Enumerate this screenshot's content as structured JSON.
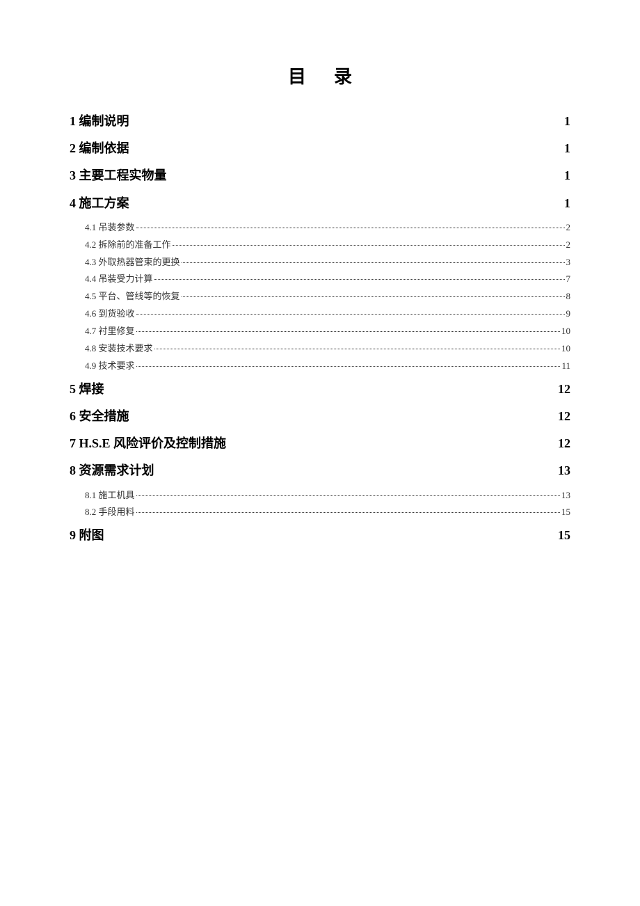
{
  "title": "目录",
  "toc": [
    {
      "num": "1",
      "label": "编制说明",
      "page": "1",
      "children": []
    },
    {
      "num": "2",
      "label": "编制依据",
      "page": "1",
      "children": []
    },
    {
      "num": "3",
      "label": "主要工程实物量",
      "page": "1",
      "children": []
    },
    {
      "num": "4",
      "label": "施工方案",
      "page": "1",
      "children": [
        {
          "num": "4.1",
          "label": "吊装参数",
          "page": "2"
        },
        {
          "num": "4.2",
          "label": "拆除前的准备工作",
          "page": "2"
        },
        {
          "num": "4.3",
          "label": "外取热器管束的更换",
          "page": "3"
        },
        {
          "num": "4.4",
          "label": "吊装受力计算",
          "page": "7"
        },
        {
          "num": "4.5",
          "label": "平台、管线等的恢复",
          "page": "8"
        },
        {
          "num": "4.6",
          "label": "到货验收",
          "page": "9"
        },
        {
          "num": "4.7",
          "label": "衬里修复",
          "page": "10"
        },
        {
          "num": "4.8",
          "label": "安装技术要求",
          "page": "10"
        },
        {
          "num": "4.9",
          "label": "技术要求",
          "page": "11"
        }
      ]
    },
    {
      "num": "5",
      "label": "焊接",
      "page": "12",
      "children": []
    },
    {
      "num": "6",
      "label": "安全措施",
      "page": "12",
      "children": []
    },
    {
      "num": "7",
      "label": "H.S.E 风险评价及控制措施",
      "page": "12",
      "children": []
    },
    {
      "num": "8",
      "label": "资源需求计划",
      "page": "13",
      "children": [
        {
          "num": "8.1",
          "label": "施工机具",
          "page": "13"
        },
        {
          "num": "8.2",
          "label": "手段用料",
          "page": "15"
        }
      ]
    },
    {
      "num": "9",
      "label": "附图",
      "page": "15",
      "children": []
    }
  ]
}
